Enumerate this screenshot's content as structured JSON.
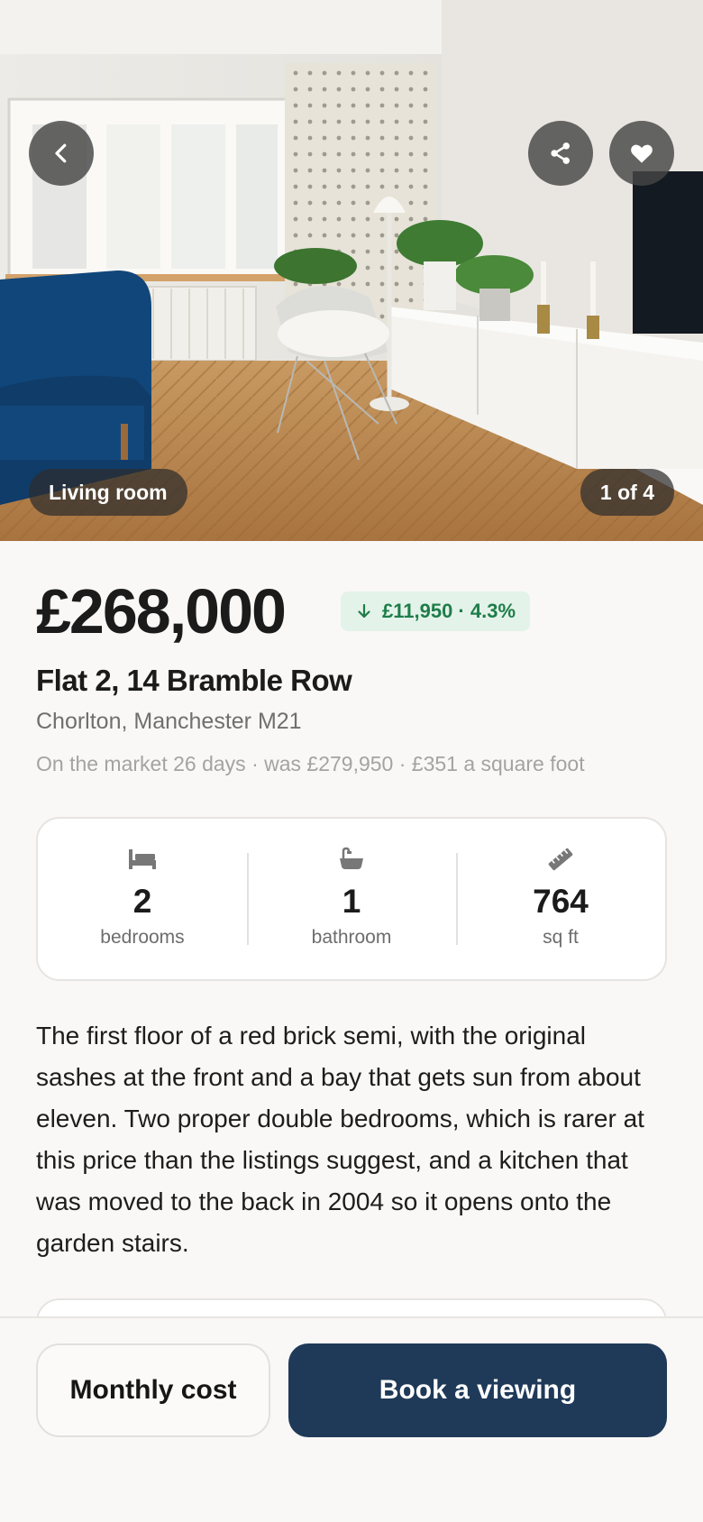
{
  "photo": {
    "room_label": "Living room",
    "counter": "1 of 4"
  },
  "toolbar": {
    "back_icon": "chevron-left-icon",
    "share_icon": "share-icon",
    "favourite_icon": "heart-icon"
  },
  "listing": {
    "price": "£268,000",
    "price_drop": "£11,950 · 4.3%",
    "title": "Flat 2, 14 Bramble Row",
    "location": "Chorlton, Manchester M21",
    "market_meta": "On the market 26 days · was £279,950 · £351 a square foot"
  },
  "stats": [
    {
      "icon": "bed-icon",
      "value": "2",
      "label": "bedrooms"
    },
    {
      "icon": "bathtub-icon",
      "value": "1",
      "label": "bathroom"
    },
    {
      "icon": "ruler-icon",
      "value": "764",
      "label": "sq ft"
    }
  ],
  "description": "The first floor of a red brick semi, with the original sashes at the front and a bay that gets sun from about eleven. Two proper double bedrooms, which is rarer at this price than the listings suggest, and a kitchen that was moved to the back in 2004 so it opens onto the garden stairs.",
  "actions": {
    "monthly_cost": "Monthly cost",
    "book_viewing": "Book a viewing"
  },
  "colors": {
    "accent": "#1f3a58",
    "price_drop_bg": "#e4f3ea",
    "price_drop_text": "#1e7d49"
  }
}
